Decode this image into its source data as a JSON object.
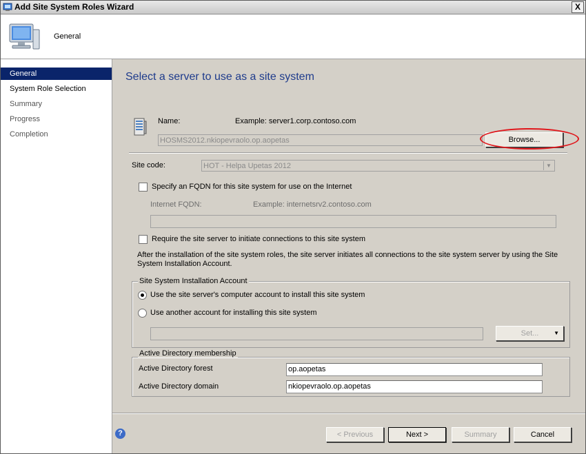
{
  "window": {
    "title": "Add Site System Roles Wizard",
    "close_label": "X"
  },
  "header": {
    "title": "General"
  },
  "sidebar": {
    "items": [
      {
        "label": "General",
        "active": true
      },
      {
        "label": "System Role Selection",
        "active": false
      },
      {
        "label": "Summary",
        "active": false
      },
      {
        "label": "Progress",
        "active": false
      },
      {
        "label": "Completion",
        "active": false
      }
    ]
  },
  "main": {
    "page_title": "Select a server to use as a site system",
    "name_label": "Name:",
    "name_example": "Example: server1.corp.contoso.com",
    "name_value": "HOSMS2012.nkiopevraolo.op.aopetas",
    "browse_label": "Browse...",
    "site_code_label": "Site code:",
    "site_code_value": "HOT - Helpa Upetas 2012",
    "fqdn_checkbox_label": "Specify an FQDN for this site system for use on the Internet",
    "internet_fqdn_label": "Internet FQDN:",
    "internet_fqdn_example": "Example: internetsrv2.contoso.com",
    "internet_fqdn_value": "",
    "require_checkbox_label": "Require the site server to initiate connections to this site system",
    "info_text": "After the  installation of the site system roles, the site server initiates all connections to the site system server by using the Site System Installation Account.",
    "install_account_group": "Site System Installation Account",
    "radio_computer_account": "Use the site server's computer account to install this site system",
    "radio_another_account": "Use another account for installing this site system",
    "account_value": "",
    "set_label": "Set...",
    "ad_group": "Active Directory membership",
    "ad_forest_label": "Active Directory forest",
    "ad_forest_value": "op.aopetas",
    "ad_domain_label": "Active Directory domain",
    "ad_domain_value": "nkiopevraolo.op.aopetas"
  },
  "footer": {
    "previous_label": "< Previous",
    "next_label": "Next >",
    "summary_label": "Summary",
    "cancel_label": "Cancel",
    "help_label": "?"
  },
  "colors": {
    "accent": "#0a246a",
    "title_blue": "#1e3b8c",
    "highlight_red": "#e0161b"
  }
}
